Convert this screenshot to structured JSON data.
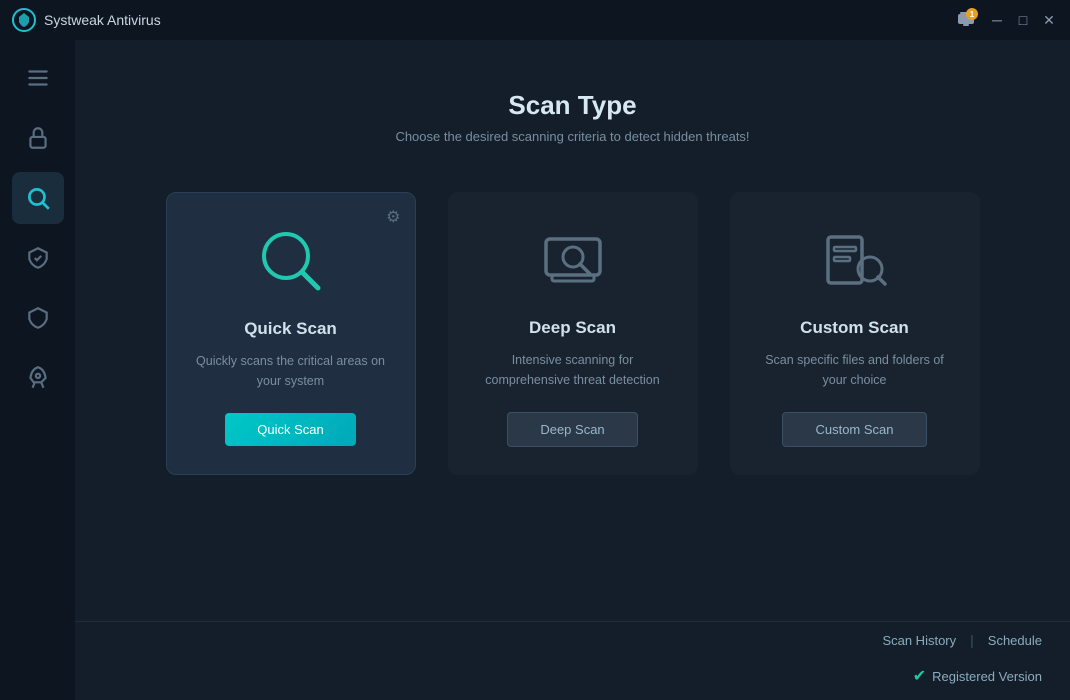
{
  "titlebar": {
    "logo_text": "Systweak Antivirus",
    "notification_count": "1"
  },
  "sidebar": {
    "items": [
      {
        "id": "menu",
        "icon": "☰",
        "label": "Menu"
      },
      {
        "id": "protection",
        "icon": "🔒",
        "label": "Protection"
      },
      {
        "id": "scan",
        "icon": "🔍",
        "label": "Scan",
        "active": true
      },
      {
        "id": "shield",
        "icon": "✓",
        "label": "Shield"
      },
      {
        "id": "security",
        "icon": "🛡",
        "label": "Security"
      },
      {
        "id": "boost",
        "icon": "🚀",
        "label": "Boost"
      }
    ]
  },
  "page": {
    "title": "Scan Type",
    "subtitle": "Choose the desired scanning criteria to detect hidden threats!"
  },
  "scan_cards": [
    {
      "id": "quick",
      "title": "Quick Scan",
      "description": "Quickly scans the critical areas on your system",
      "button_label": "Quick Scan",
      "button_type": "primary",
      "active": true,
      "has_gear": true
    },
    {
      "id": "deep",
      "title": "Deep Scan",
      "description": "Intensive scanning for comprehensive threat detection",
      "button_label": "Deep Scan",
      "button_type": "secondary",
      "active": false,
      "has_gear": false
    },
    {
      "id": "custom",
      "title": "Custom Scan",
      "description": "Scan specific files and folders of your choice",
      "button_label": "Custom Scan",
      "button_type": "secondary",
      "active": false,
      "has_gear": false
    }
  ],
  "footer": {
    "scan_history_label": "Scan History",
    "separator": "|",
    "schedule_label": "Schedule",
    "status_text": "Registered Version"
  }
}
